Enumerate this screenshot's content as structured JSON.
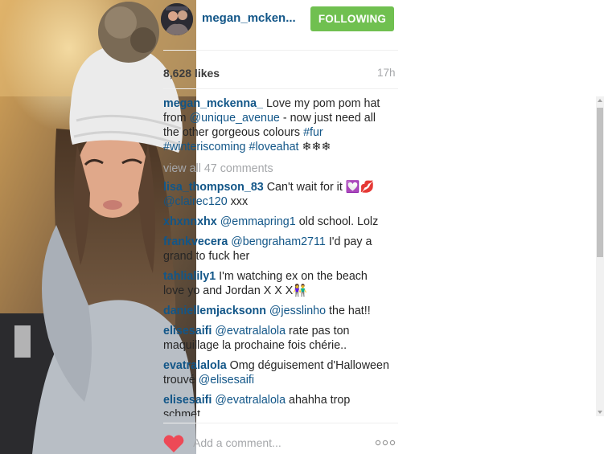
{
  "post": {
    "username": "megan_mcken...",
    "follow_label": "FOLLOWING",
    "likes": "8,628 likes",
    "time": "17h"
  },
  "caption": {
    "user": "megan_mckenna_",
    "text1": " Love my pom pom hat from ",
    "mention": "@unique_avenue",
    "text2": " - now just need all the other gorgeous colours ",
    "tag1": "#fur",
    "tag2": "#winteriscoming",
    "tag3": "#loveahat",
    "text3": " ❄❄❄"
  },
  "view_all": "view all 47 comments",
  "comments": [
    {
      "user": "lisa_thompson_83",
      "pre": " Can't wait for it 💟💋 ",
      "mention": "@clairec120",
      "post": " xxx"
    },
    {
      "user": "xhxnnxhx",
      "pre": " ",
      "mention": "@emmapring1",
      "post": " old school. Lolz"
    },
    {
      "user": "frankvecera",
      "pre": " ",
      "mention": "@bengraham2711",
      "post": " I'd pay a grand to fuck her"
    },
    {
      "user": "tahlialily1",
      "pre": " I'm watching ex on the beach love yo and Jordan X X X👫",
      "mention": "",
      "post": ""
    },
    {
      "user": "daniellemjacksonn",
      "pre": " ",
      "mention": "@jesslinho",
      "post": " the hat!!"
    },
    {
      "user": "elisesaifi",
      "pre": " ",
      "mention": "@evatralalola",
      "post": " rate pas ton maquillage la prochaine fois chérie.."
    },
    {
      "user": "evatralalola",
      "pre": " Omg déguisement d'Halloween trouvé ",
      "mention": "@elisesaifi",
      "post": ""
    },
    {
      "user": "elisesaifi",
      "pre": " ",
      "mention": "@evatralalola",
      "post": " ahahha trop schmet"
    }
  ],
  "add_comment_placeholder": "Add a comment...",
  "colors": {
    "link": "#125688",
    "follow": "#70c050",
    "heart": "#ed4956",
    "muted": "#a5a7aa"
  }
}
